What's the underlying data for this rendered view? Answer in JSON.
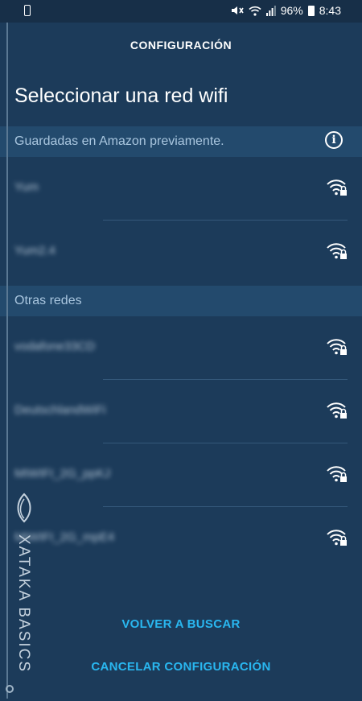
{
  "status_bar": {
    "battery_percent": "96%",
    "time": "8:43"
  },
  "header": {
    "title": "CONFIGURACIÓN"
  },
  "page": {
    "title": "Seleccionar una red wifi"
  },
  "saved_section": {
    "label": "Guardadas en Amazon previamente.",
    "networks": [
      {
        "name": "Yum"
      },
      {
        "name": "Yum2.4"
      }
    ]
  },
  "other_section": {
    "label": "Otras redes",
    "networks": [
      {
        "name": "vodafone33CD"
      },
      {
        "name": "DeutschlandWiFi"
      },
      {
        "name": "MIWIFI_2G_ppKJ"
      },
      {
        "name": "MIWIFI_2G_mpE4"
      }
    ]
  },
  "actions": {
    "rescan": "VOLVER A BUSCAR",
    "cancel": "CANCELAR CONFIGURACIÓN"
  },
  "watermark": {
    "text": "XATAKA BASICS"
  },
  "colors": {
    "background": "#1c3b5a",
    "section_header": "#234a6d",
    "accent": "#29b7f0"
  },
  "icons": {
    "network": "wifi-lock-icon",
    "info": "info-icon"
  }
}
